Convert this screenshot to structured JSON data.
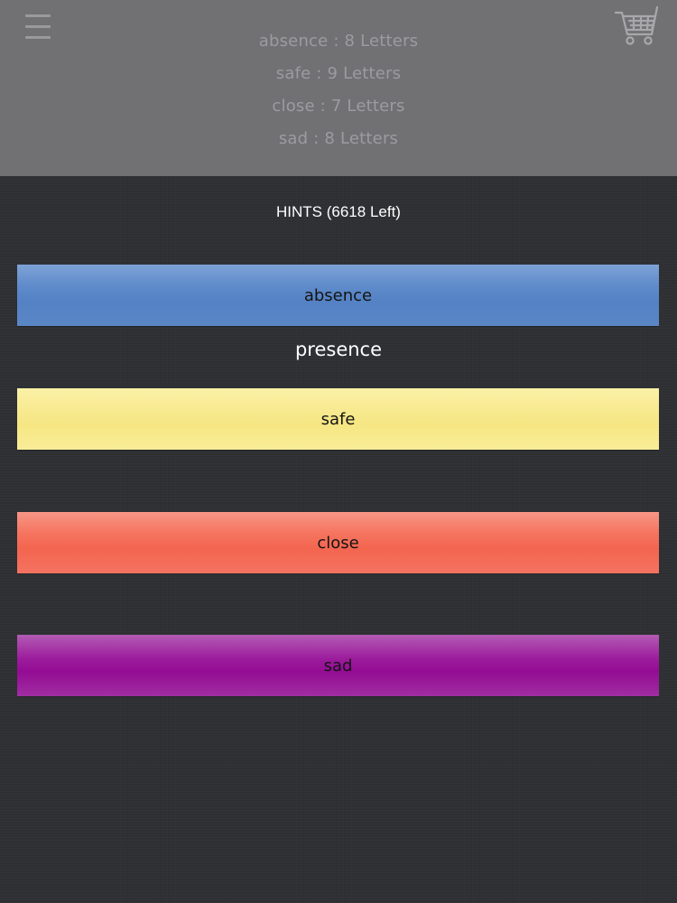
{
  "header": {
    "menu_icon": "hamburger-menu-icon",
    "cart_icon": "shopping-cart-icon",
    "words": [
      {
        "text": "absence : 8 Letters"
      },
      {
        "text": "safe : 9 Letters"
      },
      {
        "text": "close : 7 Letters"
      },
      {
        "text": "sad : 8 Letters"
      }
    ]
  },
  "hints": {
    "title": "HINTS (6618 Left)",
    "items": [
      {
        "label": "absence",
        "color": "#5a86c6",
        "answer": "presence"
      },
      {
        "label": "safe",
        "color": "#f6e683",
        "answer": ""
      },
      {
        "label": "close",
        "color": "#f3654f",
        "answer": ""
      },
      {
        "label": "sad",
        "color": "#930c93",
        "answer": ""
      }
    ]
  },
  "colors": {
    "background": "#2f3034",
    "header_overlay": "#717174",
    "text_light": "#ffffff"
  }
}
